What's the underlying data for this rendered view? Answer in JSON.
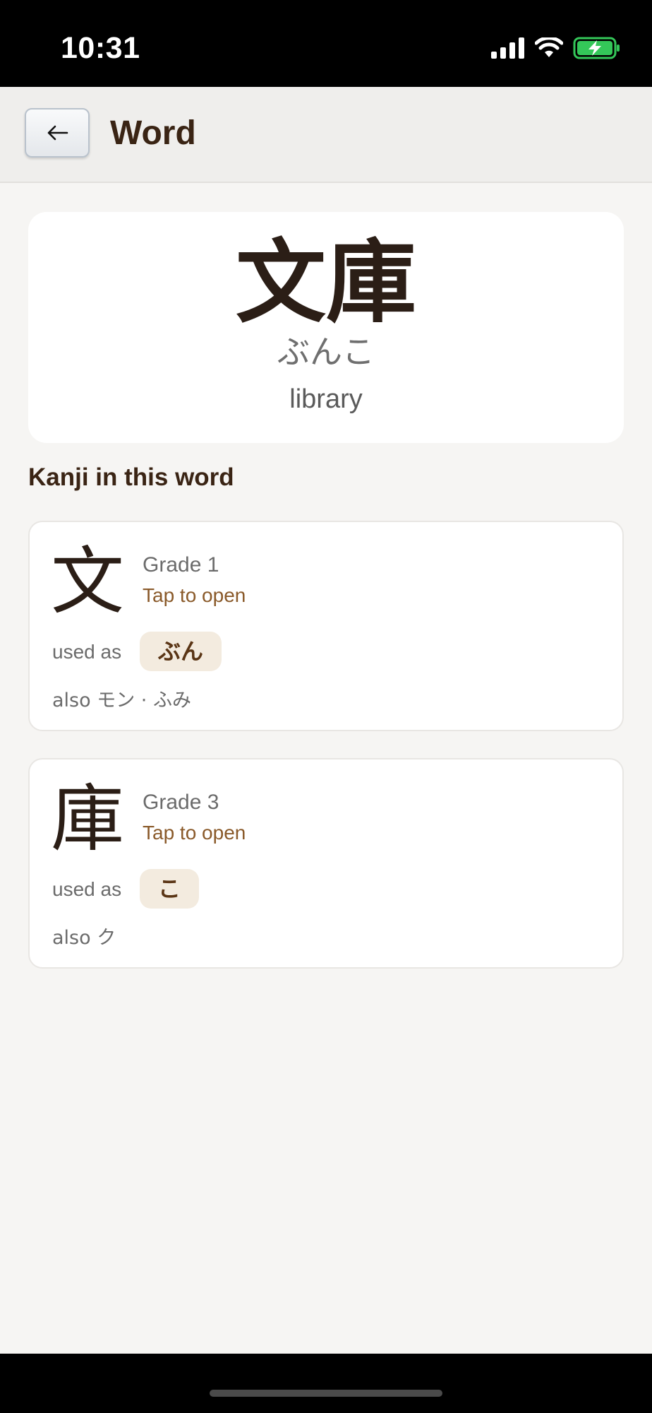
{
  "status_bar": {
    "time": "10:31"
  },
  "header": {
    "title": "Word",
    "back_icon": "arrow-left-icon"
  },
  "word": {
    "kanji": "文庫",
    "reading": "ぶんこ",
    "meaning": "library"
  },
  "section_heading": "Kanji in this word",
  "kanji_cards": [
    {
      "char": "文",
      "grade": "Grade 1",
      "tap_label": "Tap to open",
      "used_as_label": "used as",
      "used_as": "ぶん",
      "also": "also モン · ふみ"
    },
    {
      "char": "庫",
      "grade": "Grade 3",
      "tap_label": "Tap to open",
      "used_as_label": "used as",
      "used_as": "こ",
      "also": "also ク"
    }
  ],
  "colors": {
    "accent": "#8a5a2a",
    "title": "#3a2414",
    "pill_bg": "#f3ebdf",
    "battery": "#34c759"
  }
}
